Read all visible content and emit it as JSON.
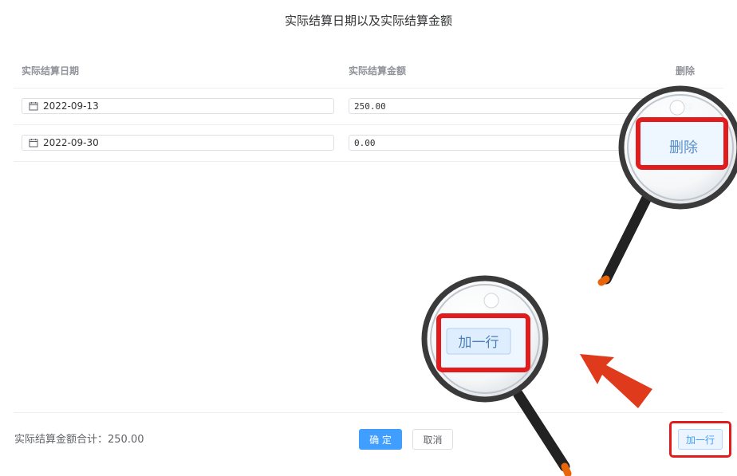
{
  "dialog": {
    "title": "实际结算日期以及实际结算金额"
  },
  "table": {
    "headers": {
      "date": "实际结算日期",
      "amount": "实际结算金额",
      "action": "删除"
    },
    "rows": [
      {
        "date": "2022-09-13",
        "amount": "250.00",
        "delete_label": "删除"
      },
      {
        "date": "2022-09-30",
        "amount": "0.00",
        "delete_label": "删除"
      }
    ]
  },
  "footer": {
    "total": "实际结算金额合计：250.00",
    "confirm": "确 定",
    "cancel": "取消",
    "add_row": "加一行"
  },
  "annotation": {
    "magnifier_delete_label": "删除",
    "magnifier_add_label": "加一行",
    "highlight_color": "#e21c1c"
  },
  "colors": {
    "primary": "#409eff",
    "border": "#dcdfe6",
    "text": "#303133"
  }
}
